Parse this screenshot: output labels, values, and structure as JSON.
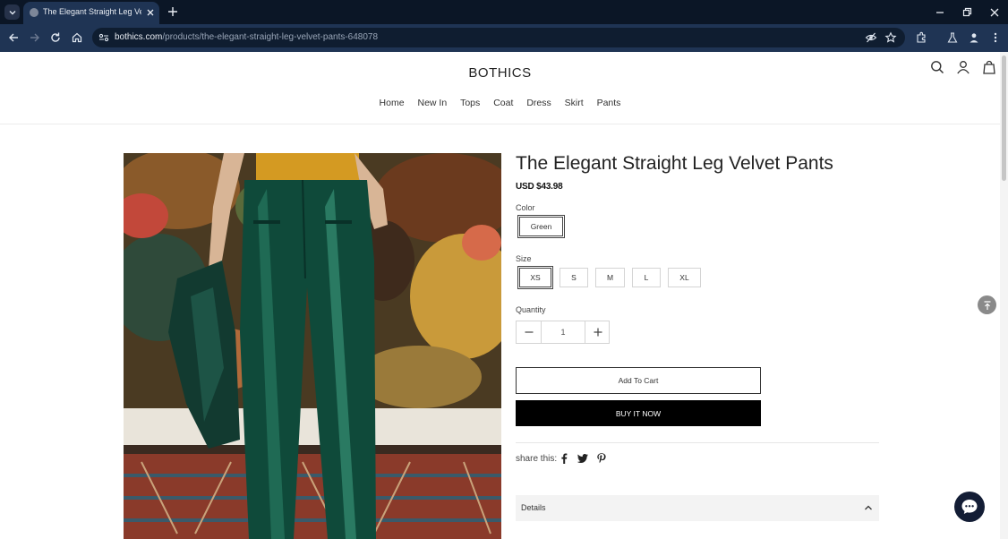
{
  "browser": {
    "tab_title": "The Elegant Straight Leg Velvet Pants",
    "url_host": "bothics.com",
    "url_path": "/products/the-elegant-straight-leg-velvet-pants-648078"
  },
  "site": {
    "logo": "BOTHICS",
    "nav": [
      "Home",
      "New In",
      "Tops",
      "Coat",
      "Dress",
      "Skirt",
      "Pants"
    ]
  },
  "product": {
    "title": "The Elegant Straight Leg Velvet Pants",
    "price": "USD $43.98",
    "color_label": "Color",
    "colors": [
      "Green"
    ],
    "selected_color": "Green",
    "size_label": "Size",
    "sizes": [
      "XS",
      "S",
      "M",
      "L",
      "XL"
    ],
    "selected_size": "XS",
    "quantity_label": "Quantity",
    "quantity": "1",
    "add_to_cart": "Add To Cart",
    "buy_now": "BUY IT NOW",
    "share_label": "share this:",
    "details_label": "Details"
  },
  "colors": {
    "tabbar_bg": "#0b1626",
    "toolbar_bg": "#1f3454",
    "buy_button_bg": "#000000",
    "chat_button_bg": "#131d35"
  }
}
